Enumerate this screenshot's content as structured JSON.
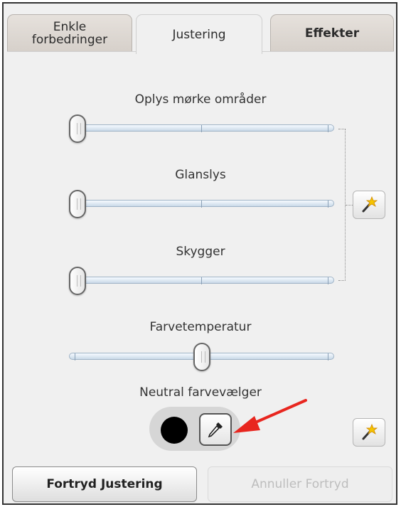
{
  "tabs": [
    {
      "label": "Enkle\nforbedringer",
      "active": false
    },
    {
      "label": "Justering",
      "active": true
    },
    {
      "label": "Effekter",
      "active": false
    }
  ],
  "sliders": [
    {
      "label": "Oplys mørke områder",
      "value_fraction": 0.0
    },
    {
      "label": "Glanslys",
      "value_fraction": 0.0
    },
    {
      "label": "Skygger",
      "value_fraction": 0.0
    },
    {
      "label": "Farvetemperatur",
      "value_fraction": 0.5
    }
  ],
  "neutral": {
    "label": "Neutral farvevælger",
    "swatch_color": "#000000",
    "picker_icon": "eyedropper-icon"
  },
  "icons": {
    "auto_fix": "magic-wand-icon",
    "annotation": "red-arrow-icon"
  },
  "buttons": {
    "undo_label": "Fortryd Justering",
    "redo_label": "Annuller Fortryd",
    "redo_enabled": false
  },
  "colors": {
    "panel_bg": "#f0f0f0",
    "track_blue": "#c9d9e8",
    "arrow_red": "#e8261f",
    "disabled_text": "#bdbdbd"
  }
}
